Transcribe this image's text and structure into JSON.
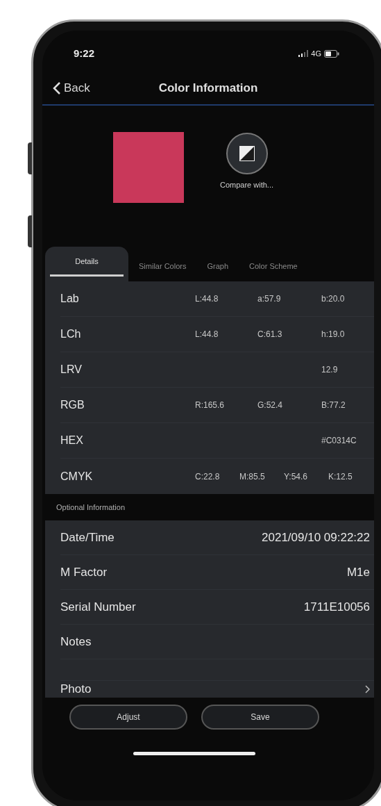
{
  "status_bar": {
    "time": "9:22",
    "network": "4G"
  },
  "nav": {
    "back": "Back",
    "title": "Color Information"
  },
  "swatch": {
    "color": "#c9385a"
  },
  "compare": {
    "label": "Compare with..."
  },
  "tabs": [
    {
      "label": "Details",
      "selected": true
    },
    {
      "label": "Similar Colors",
      "selected": false
    },
    {
      "label": "Graph",
      "selected": false
    },
    {
      "label": "Color Scheme",
      "selected": false
    }
  ],
  "details": [
    {
      "label": "Lab",
      "kind": "triple",
      "values": [
        "L:44.8",
        "a:57.9",
        "b:20.0"
      ]
    },
    {
      "label": "LCh",
      "kind": "triple",
      "values": [
        "L:44.8",
        "C:61.3",
        "h:19.0"
      ]
    },
    {
      "label": "LRV",
      "kind": "single",
      "values": [
        "12.9"
      ]
    },
    {
      "label": "RGB",
      "kind": "triple",
      "values": [
        "R:165.6",
        "G:52.4",
        "B:77.2"
      ]
    },
    {
      "label": "HEX",
      "kind": "single",
      "values": [
        "#C0314C"
      ]
    },
    {
      "label": "CMYK",
      "kind": "quad",
      "values": [
        "C:22.8",
        "M:85.5",
        "Y:54.6",
        "K:12.5"
      ]
    }
  ],
  "optional": {
    "heading": "Optional Information",
    "rows": [
      {
        "label": "Date/Time",
        "value": "2021/09/10 09:22:22",
        "kind": "text"
      },
      {
        "label": "M Factor",
        "value": "M1e",
        "kind": "text"
      },
      {
        "label": "Serial Number",
        "value": "1711E10056",
        "kind": "text"
      },
      {
        "label": "Notes",
        "kind": "notes"
      },
      {
        "label": "Photo",
        "kind": "link"
      }
    ]
  },
  "buttons": [
    "Adjust",
    "Save"
  ]
}
